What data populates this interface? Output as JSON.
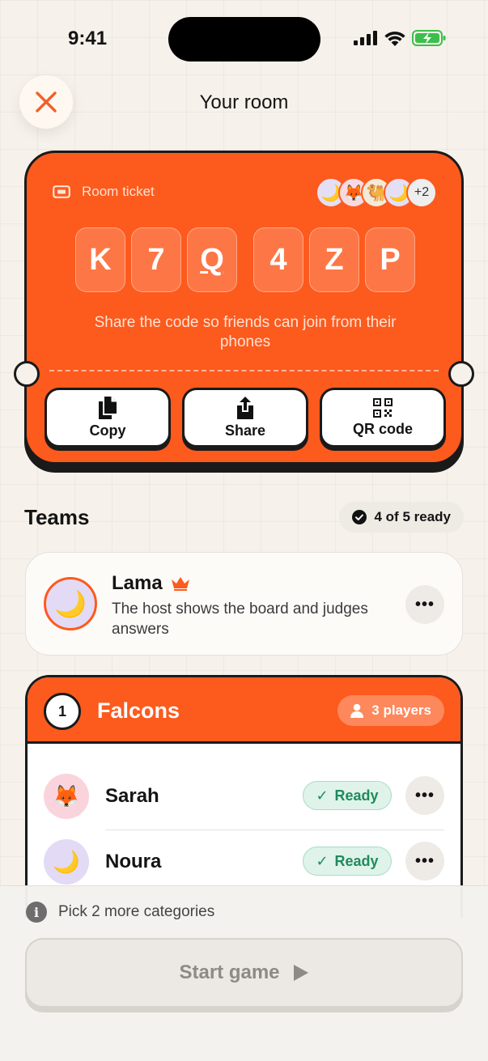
{
  "status_bar": {
    "time": "9:41"
  },
  "header": {
    "title": "Your room"
  },
  "ticket": {
    "label": "Room ticket",
    "avatars": [
      "🌙",
      "🦊",
      "🐫",
      "🌙"
    ],
    "extra_count": "+2",
    "code": [
      "K",
      "7",
      "Q",
      "4",
      "Z",
      "P"
    ],
    "subtitle": "Share the code so friends can join from their phones",
    "actions": {
      "copy": "Copy",
      "share": "Share",
      "qr": "QR code"
    }
  },
  "teams": {
    "title": "Teams",
    "ready_status": "4 of 5 ready",
    "host": {
      "name": "Lama",
      "avatar": "🌙",
      "description": "The host shows the board and judges answers"
    },
    "team": {
      "number": "1",
      "name": "Falcons",
      "players_count": "3 players",
      "players": [
        {
          "name": "Sarah",
          "avatar": "🦊",
          "status": "Ready"
        },
        {
          "name": "Noura",
          "avatar": "🌙",
          "status": "Ready"
        }
      ]
    }
  },
  "footer": {
    "hint": "Pick 2 more categories",
    "start_label": "Start game"
  },
  "colors": {
    "accent": "#fd5a1e",
    "ready_green": "#1f8b5b",
    "ink": "#1a1a1a"
  }
}
